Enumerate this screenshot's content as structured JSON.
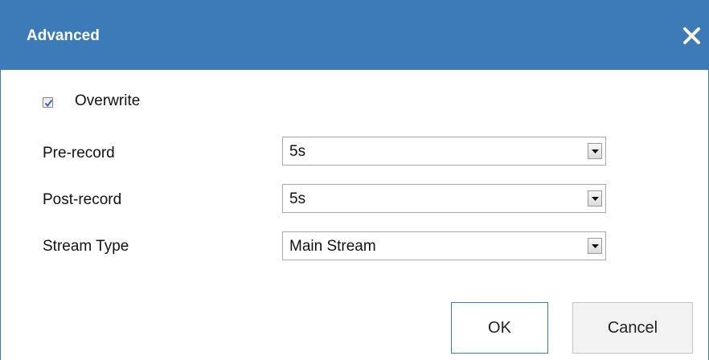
{
  "dialog": {
    "title": "Advanced",
    "close_icon": "close-icon"
  },
  "overwrite": {
    "label": "Overwrite",
    "checked": true
  },
  "fields": {
    "pre_record": {
      "label": "Pre-record",
      "value": "5s"
    },
    "post_record": {
      "label": "Post-record",
      "value": "5s"
    },
    "stream_type": {
      "label": "Stream Type",
      "value": "Main Stream"
    }
  },
  "buttons": {
    "ok": "OK",
    "cancel": "Cancel"
  },
  "colors": {
    "titlebar": "#3d7ab8",
    "title_text": "#ffffff"
  }
}
